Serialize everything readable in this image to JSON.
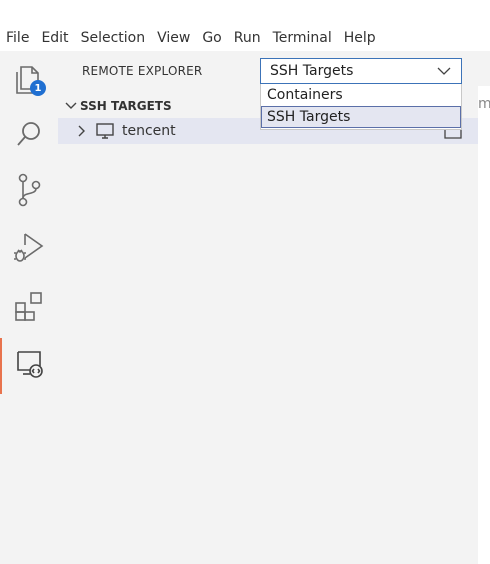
{
  "menu": {
    "items": [
      "File",
      "Edit",
      "Selection",
      "View",
      "Go",
      "Run",
      "Terminal",
      "Help"
    ]
  },
  "activity_bar": {
    "explorer_badge": "1",
    "accent_color": "#e8734d",
    "badge_color": "#1f6fd1"
  },
  "sidebar": {
    "title": "REMOTE EXPLORER",
    "select": {
      "value": "SSH Targets",
      "options": [
        "Containers",
        "SSH Targets"
      ]
    },
    "section": {
      "title": "SSH TARGETS"
    },
    "targets": [
      {
        "label": "tencent"
      }
    ]
  },
  "editor": {
    "clipped_text": "m"
  }
}
